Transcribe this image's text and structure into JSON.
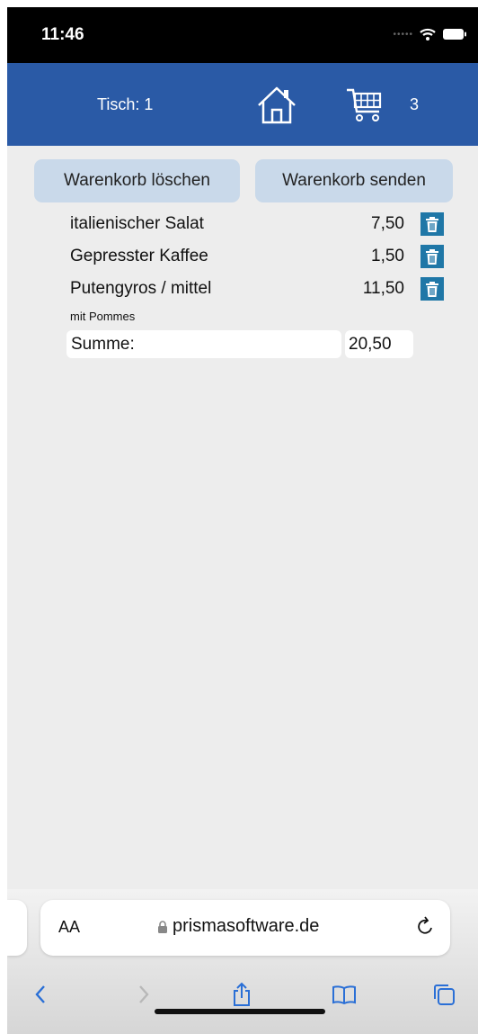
{
  "status_bar": {
    "time": "11:46"
  },
  "header": {
    "table_label": "Tisch: 1",
    "cart_count": "3"
  },
  "buttons": {
    "clear_label": "Warenkorb löschen",
    "send_label": "Warenkorb senden"
  },
  "cart": {
    "items": [
      {
        "name": "italienischer Salat",
        "price": "7,50"
      },
      {
        "name": "Gepresster Kaffee",
        "price": "1,50"
      },
      {
        "name": "Putengyros / mittel",
        "price": "11,50",
        "note": "mit Pommes"
      }
    ],
    "sum_label": "Summe:",
    "sum_value": "20,50"
  },
  "browser": {
    "text_size_label": "AA",
    "url": "prismasoftware.de"
  },
  "colors": {
    "header": "#2a5aa6",
    "button": "#c9d9ea",
    "trash": "#1f77a7"
  },
  "icons": [
    "home-icon",
    "cart-icon",
    "trash-icon",
    "lock-icon",
    "reload-icon",
    "back-icon",
    "forward-icon",
    "share-icon",
    "bookmarks-icon",
    "tabs-icon"
  ]
}
